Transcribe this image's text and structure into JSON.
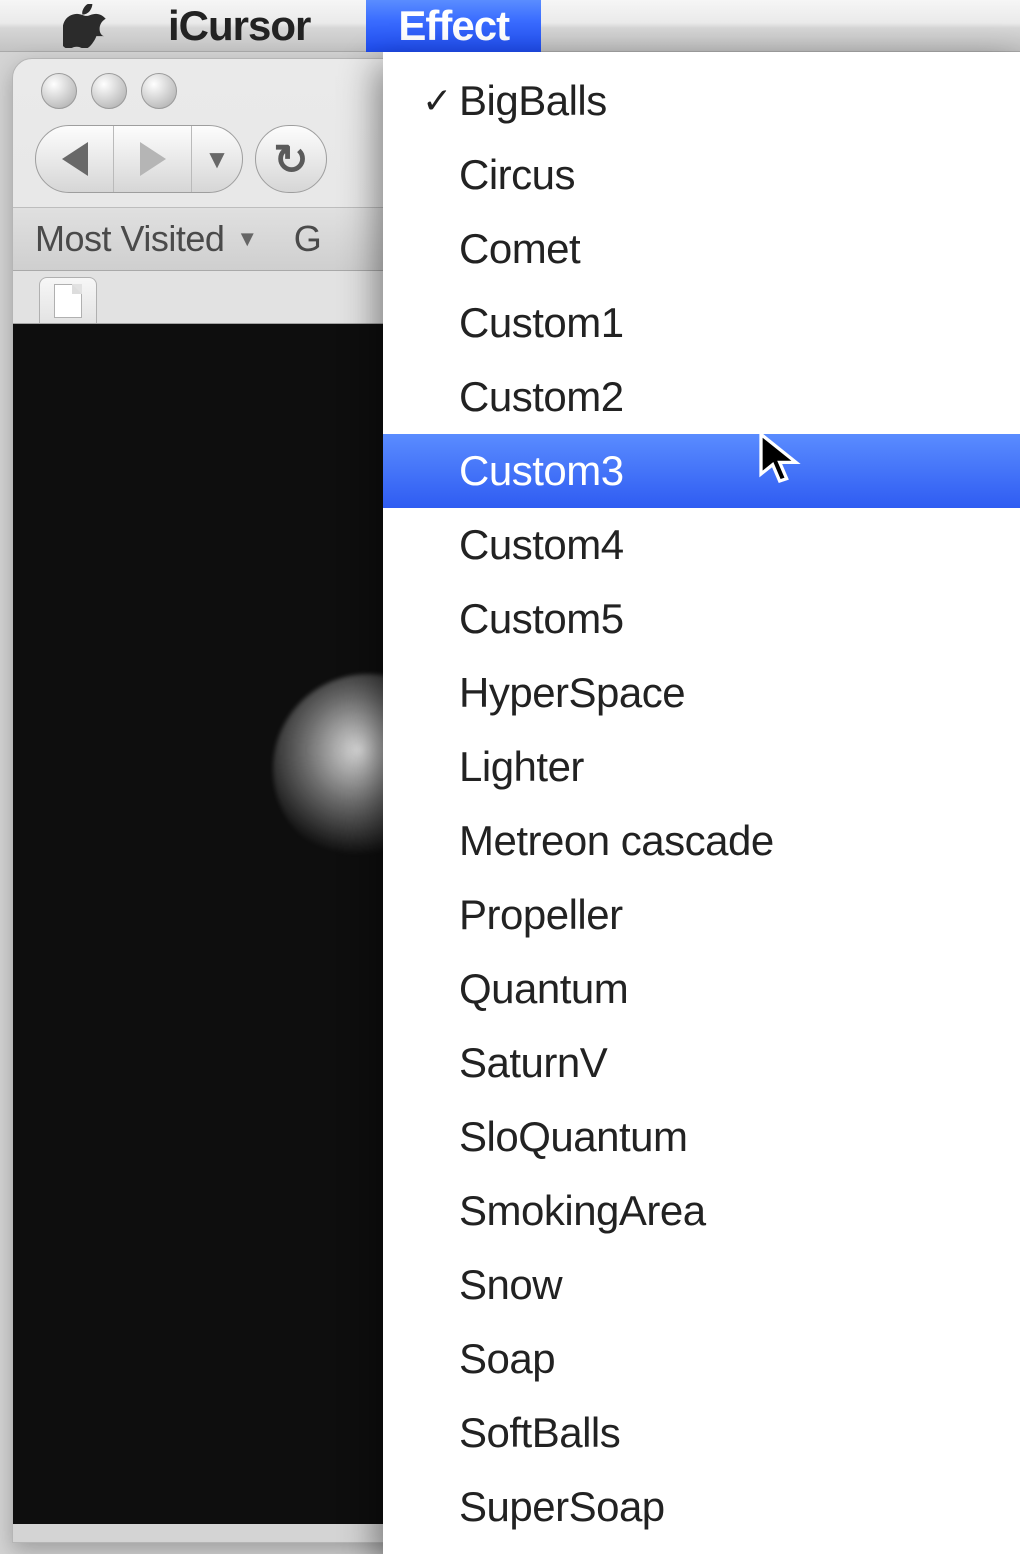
{
  "menubar": {
    "app_name": "iCursor",
    "open_menu": "Effect"
  },
  "window": {
    "bookmarks": {
      "most_visited": "Most Visited",
      "second_partial": "G"
    }
  },
  "effect_menu": {
    "items": [
      {
        "label": "BigBalls",
        "checked": true,
        "highlighted": false
      },
      {
        "label": "Circus",
        "checked": false,
        "highlighted": false
      },
      {
        "label": "Comet",
        "checked": false,
        "highlighted": false
      },
      {
        "label": "Custom1",
        "checked": false,
        "highlighted": false
      },
      {
        "label": "Custom2",
        "checked": false,
        "highlighted": false
      },
      {
        "label": "Custom3",
        "checked": false,
        "highlighted": true
      },
      {
        "label": "Custom4",
        "checked": false,
        "highlighted": false
      },
      {
        "label": "Custom5",
        "checked": false,
        "highlighted": false
      },
      {
        "label": "HyperSpace",
        "checked": false,
        "highlighted": false
      },
      {
        "label": "Lighter",
        "checked": false,
        "highlighted": false
      },
      {
        "label": "Metreon cascade",
        "checked": false,
        "highlighted": false
      },
      {
        "label": "Propeller",
        "checked": false,
        "highlighted": false
      },
      {
        "label": "Quantum",
        "checked": false,
        "highlighted": false
      },
      {
        "label": "SaturnV",
        "checked": false,
        "highlighted": false
      },
      {
        "label": "SloQuantum",
        "checked": false,
        "highlighted": false
      },
      {
        "label": "SmokingArea",
        "checked": false,
        "highlighted": false
      },
      {
        "label": "Snow",
        "checked": false,
        "highlighted": false
      },
      {
        "label": "Soap",
        "checked": false,
        "highlighted": false
      },
      {
        "label": "SoftBalls",
        "checked": false,
        "highlighted": false
      },
      {
        "label": "SuperSoap",
        "checked": false,
        "highlighted": false
      }
    ]
  }
}
